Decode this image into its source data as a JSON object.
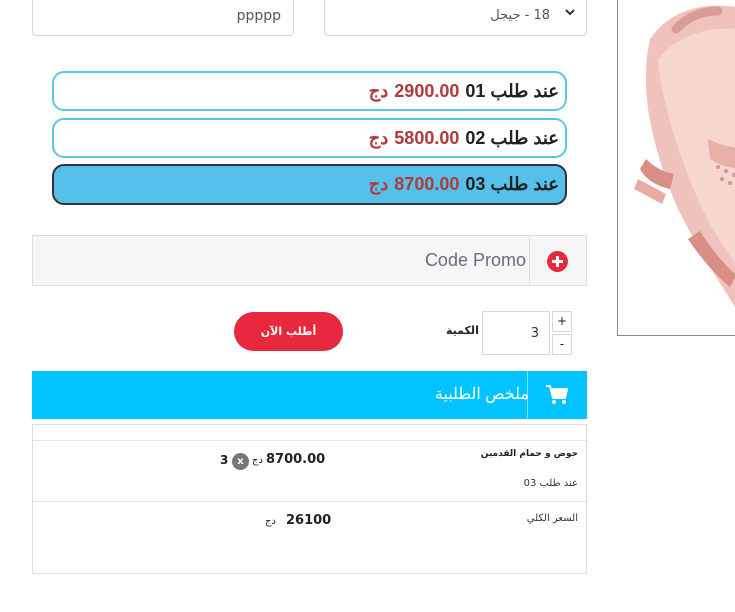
{
  "form": {
    "name_value": "ppppp",
    "wilaya_value": "18 - جيجل"
  },
  "offers": [
    {
      "label": "عند طلب 01",
      "price": "2900.00",
      "currency": "دج",
      "selected": false
    },
    {
      "label": "عند طلب 02",
      "price": "5800.00",
      "currency": "دج",
      "selected": false
    },
    {
      "label": "عند طلب 03",
      "price": "8700.00",
      "currency": "دج",
      "selected": true
    }
  ],
  "promo": {
    "label": "Code Promo",
    "icon": "plus-circle-icon"
  },
  "order": {
    "button_label": "أطلب الآن",
    "quantity_label": "الكمية",
    "quantity": "3",
    "increment": "+",
    "decrement": "-"
  },
  "summary": {
    "title": "ملخص الطلبية",
    "icon": "cart-icon",
    "product_name": "حوض و حمام القدمين",
    "product_offer": "عند طلب 03",
    "line_price": "8700.00",
    "currency": "دج",
    "remove_symbol": "x",
    "line_quantity": "3",
    "total_label": "السعر الكلي",
    "total_value": "26100",
    "total_currency": "دج"
  },
  "colors": {
    "accent_blue": "#00c3ff",
    "selected_offer": "#55c0ea",
    "offer_border": "#5bc5e8",
    "price_red": "#b23a3a",
    "button_red": "#e8283e"
  }
}
